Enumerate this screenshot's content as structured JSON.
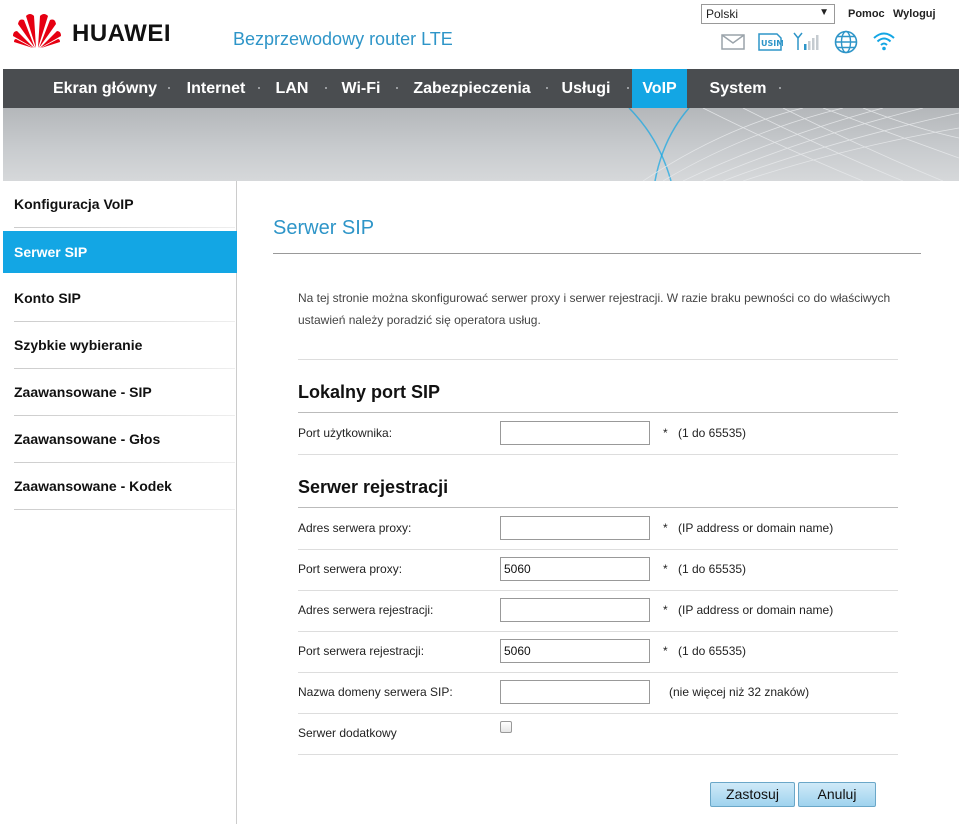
{
  "header": {
    "brand": "HUAWEI",
    "product": "Bezprzewodowy router LTE",
    "language": "Polski",
    "help": "Pomoc",
    "logout": "Wyloguj",
    "icons": [
      "mail-icon",
      "usim-icon",
      "signal-icon",
      "globe-icon",
      "wifi-icon"
    ],
    "usim_label": "USIM"
  },
  "nav": {
    "items": [
      {
        "label": "Ekran główny"
      },
      {
        "label": "Internet"
      },
      {
        "label": "LAN"
      },
      {
        "label": "Wi-Fi"
      },
      {
        "label": "Zabezpieczenia"
      },
      {
        "label": "Usługi"
      },
      {
        "label": "VoIP",
        "active": true
      },
      {
        "label": "System"
      }
    ]
  },
  "sidebar": {
    "items": [
      {
        "label": "Konfiguracja VoIP"
      },
      {
        "label": "Serwer SIP",
        "active": true
      },
      {
        "label": "Konto SIP"
      },
      {
        "label": "Szybkie wybieranie"
      },
      {
        "label": "Zaawansowane - SIP"
      },
      {
        "label": "Zaawansowane - Głos"
      },
      {
        "label": "Zaawansowane - Kodek"
      }
    ]
  },
  "main": {
    "title": "Serwer SIP",
    "description": "Na tej stronie można skonfigurować serwer proxy i serwer rejestracji. W razie braku pewności co do właściwych ustawień należy poradzić się operatora usług.",
    "local_section": {
      "title": "Lokalny port SIP",
      "user_port": {
        "label": "Port użytkownika:",
        "value": "",
        "required": "*",
        "hint": "(1 do 65535)"
      }
    },
    "reg_section": {
      "title": "Serwer rejestracji",
      "proxy_address": {
        "label": "Adres serwera proxy:",
        "value": "",
        "required": "*",
        "hint": "(IP address or domain name)"
      },
      "proxy_port": {
        "label": "Port serwera proxy:",
        "value": "5060",
        "required": "*",
        "hint": "(1 do 65535)"
      },
      "reg_address": {
        "label": "Adres serwera rejestracji:",
        "value": "",
        "required": "*",
        "hint": "(IP address or domain name)"
      },
      "reg_port": {
        "label": "Port serwera rejestracji:",
        "value": "5060",
        "required": "*",
        "hint": "(1 do 65535)"
      },
      "sip_domain": {
        "label": "Nazwa domeny serwera SIP:",
        "value": "",
        "hint": "(nie więcej niż 32 znaków)"
      },
      "secondary_server": {
        "label": "Serwer dodatkowy",
        "checked": false
      }
    },
    "buttons": {
      "apply": "Zastosuj",
      "cancel": "Anuluj"
    }
  },
  "colors": {
    "accent": "#13a6e4",
    "nav_bg": "#4a4d50",
    "title_blue": "#2e95c8",
    "logo_red": "#e60012"
  }
}
